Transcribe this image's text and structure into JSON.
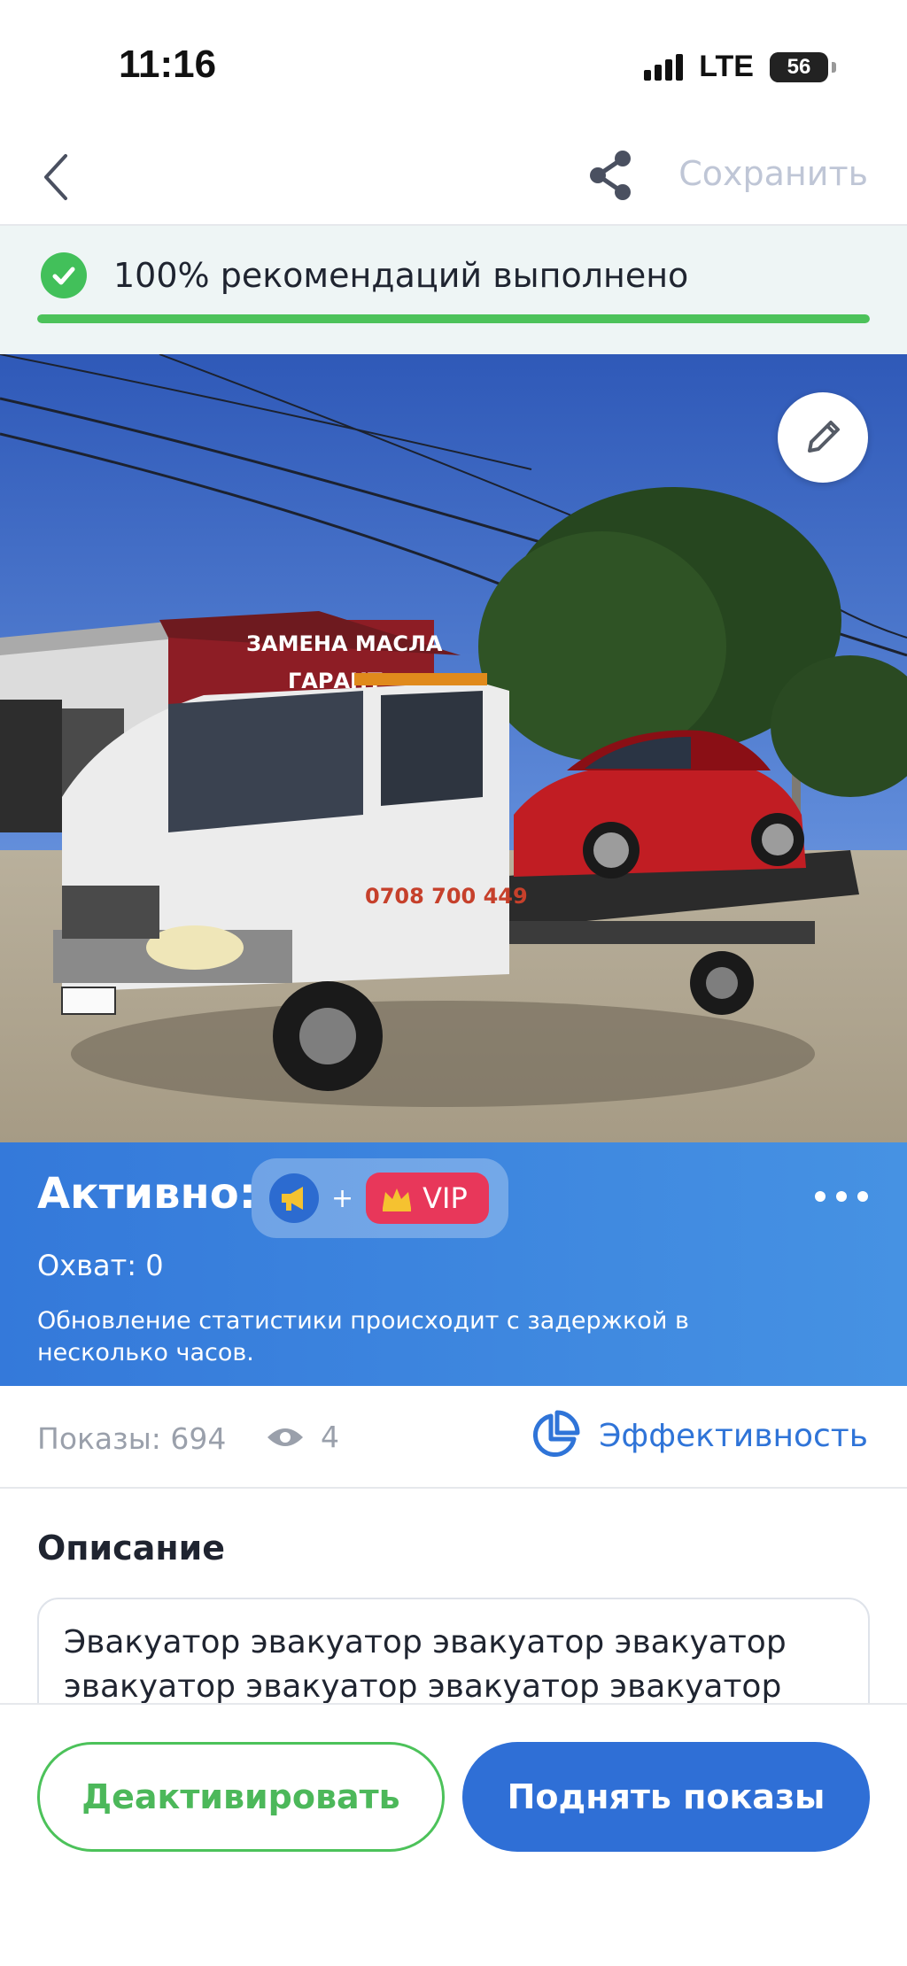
{
  "status_bar": {
    "time": "11:16",
    "network": "LTE",
    "battery": "56",
    "battery_level_percent": 56
  },
  "nav": {
    "back_icon": "chevron-left-icon",
    "share_icon": "share-icon",
    "save_label": "Сохранить"
  },
  "recommendations": {
    "text": "100% рекомендаций выполнено",
    "progress_percent": 100,
    "color": "#4cc25a"
  },
  "photo": {
    "truck_phone": "0708 700 449",
    "sign_text": "ЗАМЕНА МАСЛА",
    "sign_subtext": "ГАРАНТ",
    "edit_icon": "pencil-icon"
  },
  "active": {
    "title": "Активно:",
    "plus": "+",
    "vip_label": "VIP",
    "reach": "Охват: 0",
    "delay_note": "Обновление статистики происходит с задержкой в несколько часов."
  },
  "stats": {
    "impressions": "Показы: 694",
    "views": "4",
    "efficiency_label": "Эффективность"
  },
  "description": {
    "title": "Описание",
    "text": "Эвакуатор эвакуатор эвакуатор эвакуатор эвакуатор эвакуатор эвакуатор эвакуатор"
  },
  "actions": {
    "deactivate_label": "Деактивировать",
    "boost_label": "Поднять показы"
  },
  "colors": {
    "accent_blue": "#2f6fd6",
    "accent_green": "#4cc25a",
    "vip_red": "#e8375a"
  }
}
